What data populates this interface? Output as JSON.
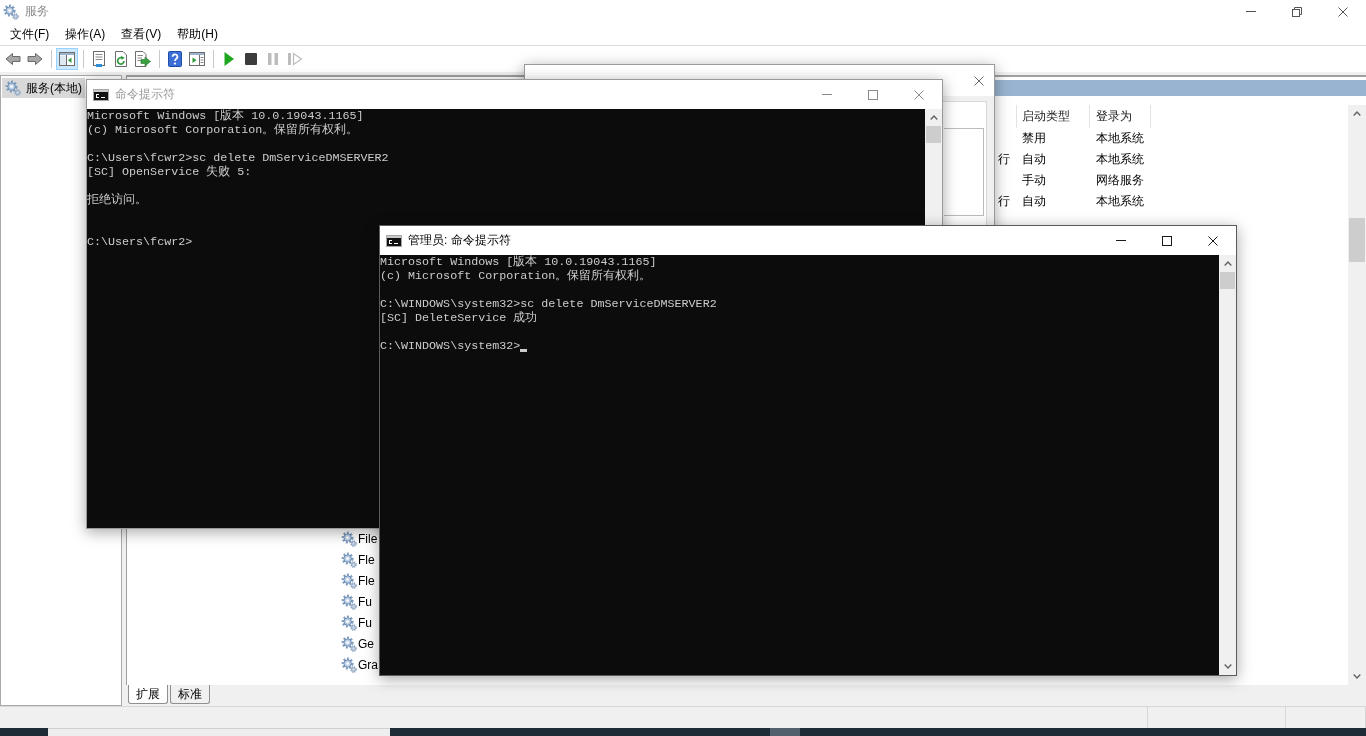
{
  "services_window": {
    "title": "服务",
    "active": false,
    "menu": [
      {
        "label": "文件(F)"
      },
      {
        "label": "操作(A)"
      },
      {
        "label": "查看(V)"
      },
      {
        "label": "帮助(H)"
      }
    ],
    "toolbar": [
      [
        {
          "kind": "back",
          "pressed": false,
          "disabled": false
        },
        {
          "kind": "forward",
          "pressed": false,
          "disabled": false
        }
      ],
      [
        {
          "kind": "console_tree",
          "pressed": true,
          "disabled": false
        }
      ],
      [
        {
          "kind": "properties",
          "pressed": false,
          "disabled": false
        },
        {
          "kind": "refresh",
          "pressed": false,
          "disabled": false
        },
        {
          "kind": "export",
          "pressed": false,
          "disabled": false
        }
      ],
      [
        {
          "kind": "help",
          "pressed": false,
          "disabled": false
        },
        {
          "kind": "action_pane",
          "pressed": false,
          "disabled": false
        }
      ],
      [
        {
          "kind": "start",
          "pressed": false,
          "disabled": false
        },
        {
          "kind": "stop",
          "pressed": false,
          "disabled": false
        },
        {
          "kind": "pause",
          "pressed": false,
          "disabled": true
        },
        {
          "kind": "resume",
          "pressed": false,
          "disabled": true
        }
      ]
    ],
    "tree": [
      {
        "label": "服务(本地)",
        "selected": true
      }
    ],
    "list": {
      "columns": [
        {
          "label": "启动类型"
        },
        {
          "label": "登录为"
        }
      ],
      "top_rows": [
        {
          "startup": "禁用",
          "logon": "本地系统"
        },
        {
          "status": "行",
          "startup": "自动",
          "logon": "本地系统"
        },
        {
          "startup": "手动",
          "logon": "网络服务"
        },
        {
          "status": "行",
          "startup": "自动",
          "logon": "本地系统"
        }
      ],
      "bottom_rows": [
        {
          "name": "File"
        },
        {
          "name": "Fle"
        },
        {
          "name": "Fle"
        },
        {
          "name": "Fu"
        },
        {
          "name": "Fu"
        },
        {
          "name": "Ge"
        },
        {
          "name": "Gra"
        }
      ]
    },
    "view_tabs": [
      {
        "label": "扩展",
        "selected": true
      },
      {
        "label": "标准",
        "selected": false
      }
    ]
  },
  "windows": [
    {
      "kind": "dialog"
    },
    {
      "kind": "console",
      "title": "命令提示符",
      "active": false,
      "cursor": false,
      "lines": [
        {
          "kind": "text",
          "text": "Microsoft Windows [版本 10.0.19043.1165]"
        },
        {
          "kind": "text",
          "text": "(c) Microsoft Corporation。保留所有权利。"
        },
        {
          "kind": "blank"
        },
        {
          "kind": "text",
          "text": "C:\\Users\\fcwr2>sc delete DmServiceDMSERVER2"
        },
        {
          "kind": "text",
          "text": "[SC] OpenService 失败 5:"
        },
        {
          "kind": "blank"
        },
        {
          "kind": "text",
          "text": "拒绝访问。"
        },
        {
          "kind": "blank"
        },
        {
          "kind": "blank"
        },
        {
          "kind": "text",
          "text": "C:\\Users\\fcwr2>"
        }
      ]
    },
    {
      "kind": "console",
      "title": "管理员: 命令提示符",
      "active": true,
      "cursor": true,
      "lines": [
        {
          "kind": "text",
          "text": "Microsoft Windows [版本 10.0.19043.1165]"
        },
        {
          "kind": "text",
          "text": "(c) Microsoft Corporation。保留所有权利。"
        },
        {
          "kind": "blank"
        },
        {
          "kind": "text",
          "text": "C:\\WINDOWS\\system32>sc delete DmServiceDMSERVER2"
        },
        {
          "kind": "text",
          "text": "[SC] DeleteService 成功"
        },
        {
          "kind": "blank"
        },
        {
          "kind": "text",
          "text": "C:\\WINDOWS\\system32>"
        }
      ]
    }
  ]
}
